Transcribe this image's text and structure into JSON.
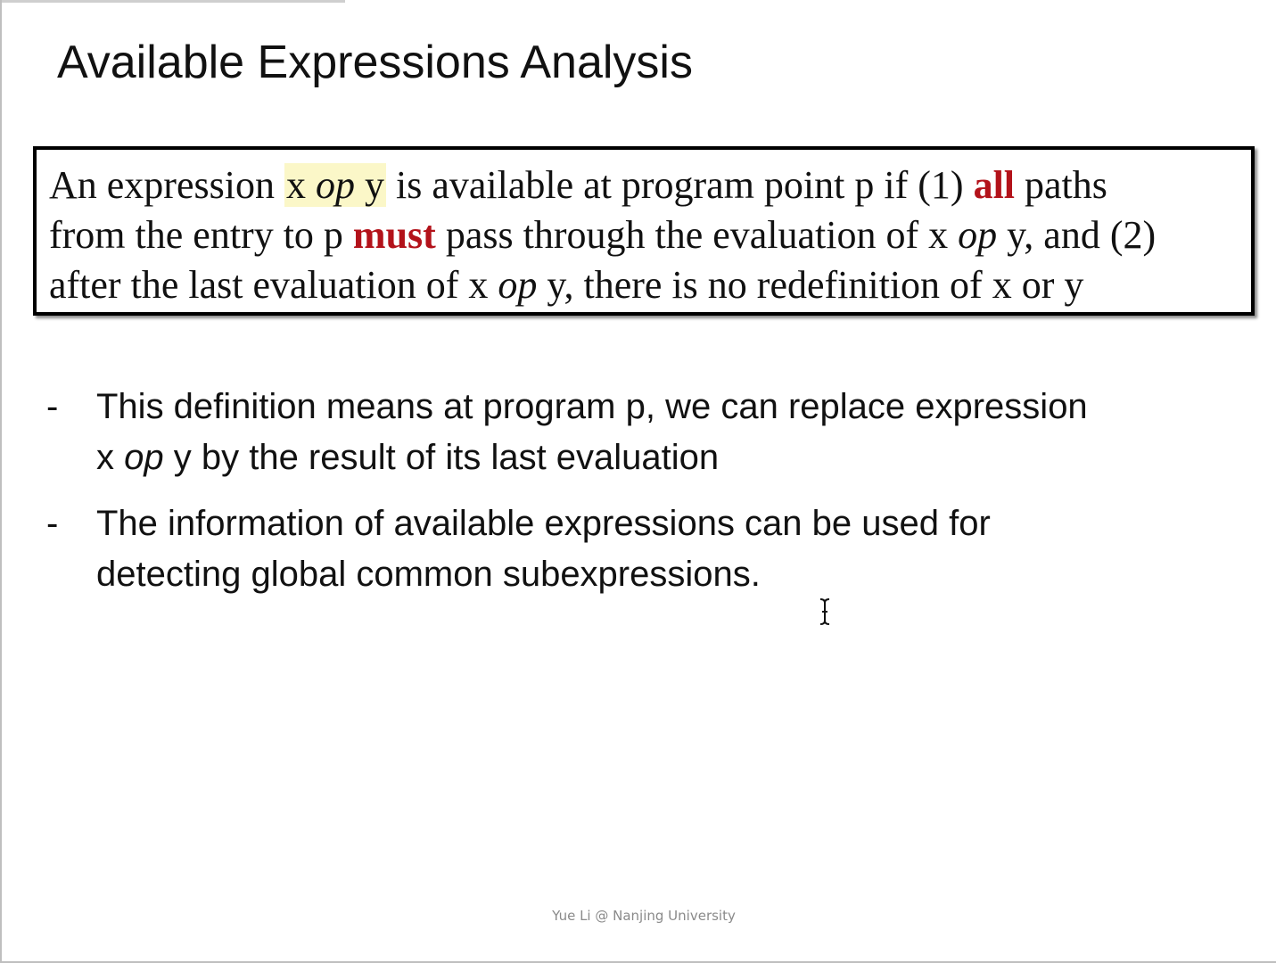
{
  "slide": {
    "title": "Available Expressions Analysis",
    "definition": {
      "line1": {
        "a": "An expression ",
        "hl_x": "x ",
        "hl_op": "op",
        "hl_y": " y",
        "b": " is available at program point p if (1) ",
        "all": "all",
        "c": " paths"
      },
      "line2": {
        "a": "from the entry to p ",
        "must": "must",
        "b": " pass through the evaluation of x ",
        "op": "op",
        "c": " y, and (2)"
      },
      "line3": {
        "a": "after the last evaluation of x ",
        "op": "op",
        "b": " y, there is no redefinition of x or y"
      }
    },
    "bullets": [
      {
        "dash": "-",
        "line1": "This definition means at program p, we can replace expression",
        "line2_a": "x ",
        "line2_op": "op",
        "line2_b": " y by the result of its last evaluation"
      },
      {
        "dash": "-",
        "line1": "The information of available expressions can be used for",
        "line2": "detecting global common subexpressions."
      }
    ],
    "footer": "Yue Li @ Nanjing University"
  },
  "colors": {
    "emphasis_red": "#b3121a",
    "highlight_yellow": "#fbf7c8"
  },
  "icons": {
    "cursor": "text-cursor-icon"
  }
}
